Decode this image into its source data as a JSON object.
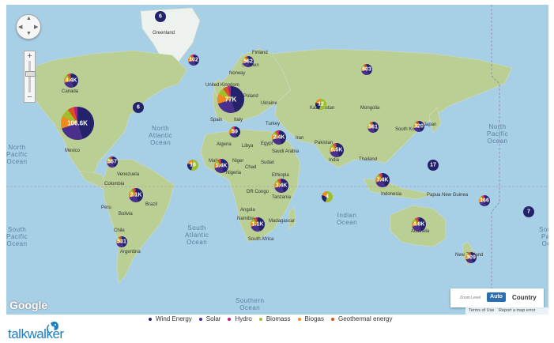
{
  "map": {
    "ocean_color": "#a7d0e7",
    "land_color": "#b9cf93",
    "country_labels": [
      "Greenland",
      "Finland",
      "Norway",
      "Sweden",
      "United Kingdom",
      "Poland",
      "Ukraine",
      "Spain",
      "Italy",
      "Turkey",
      "Kazakhstan",
      "Mongolia",
      "Canada",
      "Mexico",
      "Algeria",
      "Libya",
      "Egypt",
      "Iran",
      "Saudi Arabia",
      "Mali",
      "Niger",
      "Chad",
      "Nigeria",
      "Sudan",
      "Ethiopia",
      "Pakistan",
      "India",
      "South Korea",
      "Japan",
      "Thailand",
      "Venezuela",
      "Colombia",
      "Peru",
      "Brazil",
      "Bolivia",
      "Chile",
      "Argentina",
      "DR Congo",
      "Tanzania",
      "Angola",
      "Namibia",
      "Madagascar",
      "South Africa",
      "Indonesia",
      "Papua New Guinea",
      "Australia",
      "New Zealand"
    ],
    "ocean_labels": [
      {
        "name": "north-pacific-west",
        "text": "North\nPacific\nOcean"
      },
      {
        "name": "north-atlantic",
        "text": "North\nAtlantic\nOcean"
      },
      {
        "name": "north-pacific-east",
        "text": "North\nPacific\nOcean"
      },
      {
        "name": "south-pacific-west",
        "text": "South\nPacific\nOcean"
      },
      {
        "name": "south-atlantic",
        "text": "South\nAtlantic\nOcean"
      },
      {
        "name": "indian",
        "text": "Indian\nOcean"
      },
      {
        "name": "south-pacific-east",
        "text": "South\nPaci\nOce"
      },
      {
        "name": "southern",
        "text": "Southern\nOcean"
      }
    ]
  },
  "markers": [
    {
      "label": "6",
      "size": "s",
      "mix": "wind"
    },
    {
      "label": "102",
      "size": "s",
      "mix": "mixed"
    },
    {
      "label": "562",
      "size": "s",
      "mix": "mixed"
    },
    {
      "label": "603",
      "size": "s",
      "mix": "mixed"
    },
    {
      "label": "4.4K",
      "size": "m",
      "mix": "mixed"
    },
    {
      "label": "6",
      "size": "s",
      "mix": "wind"
    },
    {
      "label": "77K",
      "size": "l",
      "mix": "mixed"
    },
    {
      "label": "106.6K",
      "size": "xl",
      "mix": "mixed"
    },
    {
      "label": "12",
      "size": "s",
      "mix": "biomass"
    },
    {
      "label": "59",
      "size": "s",
      "mix": "mixed"
    },
    {
      "label": "561",
      "size": "s",
      "mix": "mixed"
    },
    {
      "label": "320",
      "size": "s",
      "mix": "mixed"
    },
    {
      "label": "2.4K",
      "size": "m",
      "mix": "mixed"
    },
    {
      "label": "6.5K",
      "size": "m",
      "mix": "mixed"
    },
    {
      "label": "557",
      "size": "s",
      "mix": "mixed"
    },
    {
      "label": "18",
      "size": "s",
      "mix": "biomass"
    },
    {
      "label": "1.4K",
      "size": "m",
      "mix": "mixed"
    },
    {
      "label": "17",
      "size": "s",
      "mix": "wind"
    },
    {
      "label": "7.4K",
      "size": "m",
      "mix": "mixed"
    },
    {
      "label": "3.4K",
      "size": "m",
      "mix": "mixed"
    },
    {
      "label": "2.1K",
      "size": "m",
      "mix": "mixed"
    },
    {
      "label": "4",
      "size": "s",
      "mix": "biomass"
    },
    {
      "label": "166",
      "size": "s",
      "mix": "mixed"
    },
    {
      "label": "7",
      "size": "s",
      "mix": "wind"
    },
    {
      "label": "1.1K",
      "size": "m",
      "mix": "mixed"
    },
    {
      "label": "4.8K",
      "size": "m",
      "mix": "mixed"
    },
    {
      "label": "531",
      "size": "s",
      "mix": "mixed"
    },
    {
      "label": "309",
      "size": "s",
      "mix": "mixed"
    }
  ],
  "controls": {
    "zoom_in": "+",
    "zoom_out": "−",
    "zoom_level_label": "Zoom Level",
    "auto_button": "Auto",
    "country_button": "Country",
    "terms": "Terms of Use",
    "report": "Report a map error",
    "attribution": "Google"
  },
  "legend": {
    "items": [
      {
        "label": "Wind Energy",
        "color": "#23226b"
      },
      {
        "label": "Solar",
        "color": "#4a2f8c"
      },
      {
        "label": "Hydro",
        "color": "#c2187a"
      },
      {
        "label": "Biomass",
        "color": "#9fbf2a"
      },
      {
        "label": "Biogas",
        "color": "#ef8a1e"
      },
      {
        "label": "Geothermal energy",
        "color": "#d9531e"
      }
    ]
  },
  "brand": {
    "name": "talkwalker",
    "color": "#1e7fc3"
  }
}
